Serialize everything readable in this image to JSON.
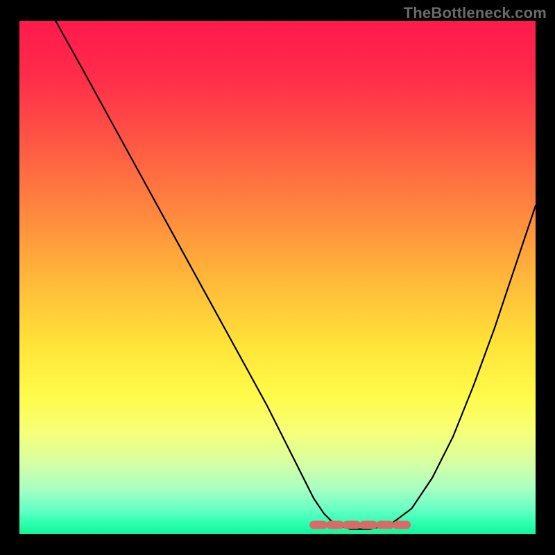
{
  "watermark": "TheBottleneck.com",
  "colors": {
    "page_bg": "#000000",
    "curve": "#000000",
    "trough_stroke": "#d86a6a",
    "gradient_top": "#ff1a4c",
    "gradient_bottom": "#13f59a"
  },
  "chart_data": {
    "type": "line",
    "title": "",
    "xlabel": "",
    "ylabel": "",
    "xlim": [
      0,
      100
    ],
    "ylim": [
      0,
      100
    ],
    "grid": false,
    "axes_visible": false,
    "legend": null,
    "background": "vertical gradient red→orange→yellow→green (low y = green)",
    "series": [
      {
        "name": "curve",
        "x": [
          7,
          12,
          18,
          24,
          30,
          36,
          42,
          48,
          52,
          55,
          57,
          59,
          61,
          64,
          68,
          72,
          76,
          80,
          84,
          88,
          92,
          96,
          100
        ],
        "y": [
          100,
          91,
          80,
          69,
          58,
          47,
          36,
          25,
          17,
          11,
          7,
          4,
          2,
          1,
          1,
          2,
          5,
          11,
          19,
          29,
          40,
          52,
          64
        ]
      }
    ],
    "annotations": [
      {
        "name": "trough-band",
        "type": "dashed-segment",
        "color": "#d86a6a",
        "x_range": [
          57,
          76
        ],
        "y": 1,
        "note": "highlighted flat minimum region"
      }
    ]
  }
}
